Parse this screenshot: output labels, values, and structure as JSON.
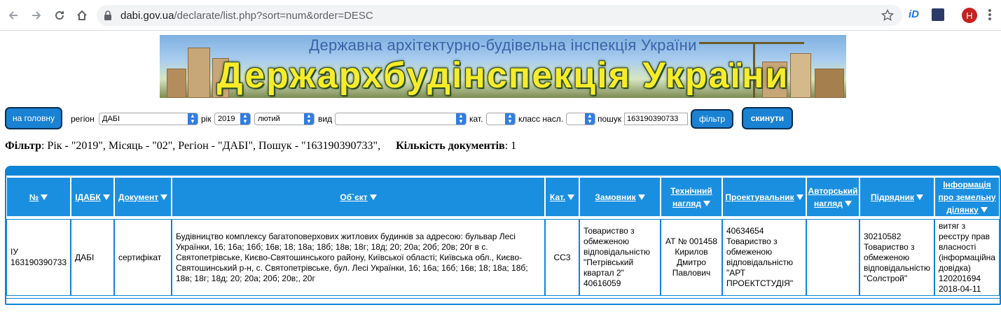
{
  "browser": {
    "url_host": "dabi.gov.ua",
    "url_path": "/declarate/list.php?sort=num&order=DESC",
    "profile_initial": "H",
    "ext1": "iD"
  },
  "banner": {
    "subtitle": "Державна архітектурно-будівельна інспекція України",
    "title": "Держархбудінспекція України"
  },
  "filters": {
    "home_label": "на головну",
    "region_label": "регіон",
    "region_value": "ДАБІ",
    "year_label": "рік",
    "year_value": "2019",
    "month_value": "лютий",
    "type_label": "вид",
    "type_value": "",
    "cat_label": "кат.",
    "cat_value": "",
    "class_label": "класс насл.",
    "class_value": "",
    "search_label": "пошук",
    "search_value": "163190390733",
    "filter_button": "фільтр",
    "reset_button": "скинути"
  },
  "summary": {
    "filter_label": "Фільтр",
    "filter_text": ": Рік - \"2019\", Місяць - \"02\", Регіон - \"ДАБІ\", Пошук - \"163190390733\",",
    "count_label": "Кількість документів",
    "count_value": ": 1"
  },
  "table": {
    "headers": {
      "num": "№",
      "idabk": "ІДАБК",
      "document": "Документ",
      "object": "Об`єкт",
      "cat": "Кат.",
      "customer_1": "Замовник",
      "tech_1": "Технічний",
      "tech_2": "нагляд",
      "designer": "Проектувальник",
      "author_1": "Авторський",
      "author_2": "нагляд",
      "contractor": "Підрядник",
      "land_1": "Інформація",
      "land_2": "про земельну",
      "land_3": "ділянку"
    },
    "row": {
      "num_1": "ІУ",
      "num_2": "163190390733",
      "idabk": "ДАБІ",
      "document": "сертифікат",
      "object": "Будівництво комплексу багатоповерхових житлових будинків за адресою: бульвар Лесі Українки, 16; 16а; 16б; 16в; 18; 18а; 18б; 18в; 18г; 18д; 20; 20а; 20б; 20в; 20г в с. Святопетрівське, Києво-Святошинського району, Київської області; Київська обл., Києво-Святошинський р-н, с. Святопетрівське, бул. Лесі Українки, 16; 16а; 16б; 16в; 18; 18а; 18б; 18в; 18г; 18д; 20; 20а; 20б; 20в;, 20г",
      "cat": "СС3",
      "customer": "Товариство з обмеженою відповідальністю \"Петрівський квартал 2\" 40616059",
      "tech": "АТ № 001458 Кирилов Дмитро Павлович",
      "designer": "40634654 Товариство з обмеженою відповідальністю \"АРТ ПРОЕКТСТУДІЯ\"",
      "author": "",
      "contractor": "30210582 Товариство з обмеженою відповідальністю \"Солстрой\"",
      "land": "витяг з реєстру прав власності (інформаційна довідка) 120201694 2018-04-11"
    }
  }
}
